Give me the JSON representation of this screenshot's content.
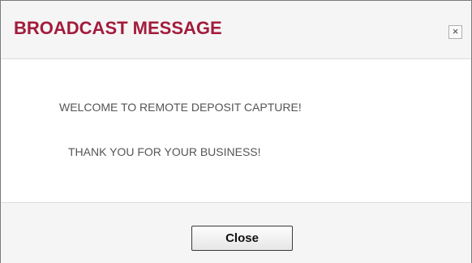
{
  "dialog": {
    "title": "BROADCAST MESSAGE",
    "title_color": "#a31b3c",
    "close_icon": "close-icon",
    "close_glyph": "×"
  },
  "messages": [
    "WELCOME TO REMOTE DEPOSIT CAPTURE!",
    "THANK YOU FOR YOUR BUSINESS!"
  ],
  "footer": {
    "close_label": "Close"
  }
}
